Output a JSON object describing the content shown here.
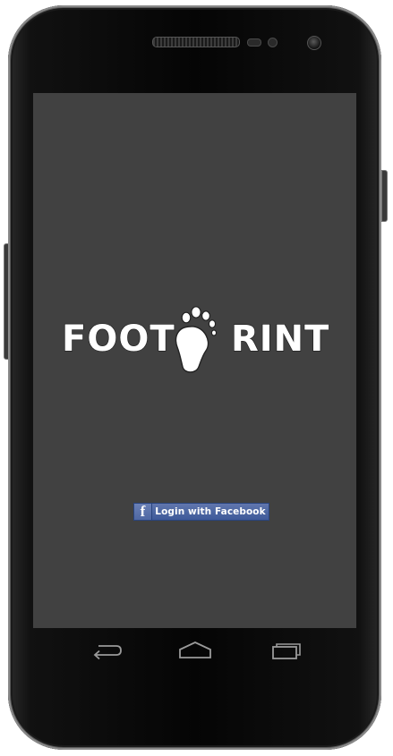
{
  "app": {
    "logo_text_left": "FOOT",
    "logo_text_right": "RINT",
    "logo_icon": "footprint-icon"
  },
  "login": {
    "facebook_button_label": "Login with Facebook",
    "facebook_icon_glyph": "f",
    "facebook_icon": "facebook-icon"
  },
  "device": {
    "nav_buttons": [
      "back-icon",
      "home-icon",
      "recent-apps-icon"
    ]
  },
  "colors": {
    "screen_background": "#414141",
    "facebook_blue": "#4d67a3",
    "logo_text": "#ffffff",
    "phone_body": "#050505"
  }
}
